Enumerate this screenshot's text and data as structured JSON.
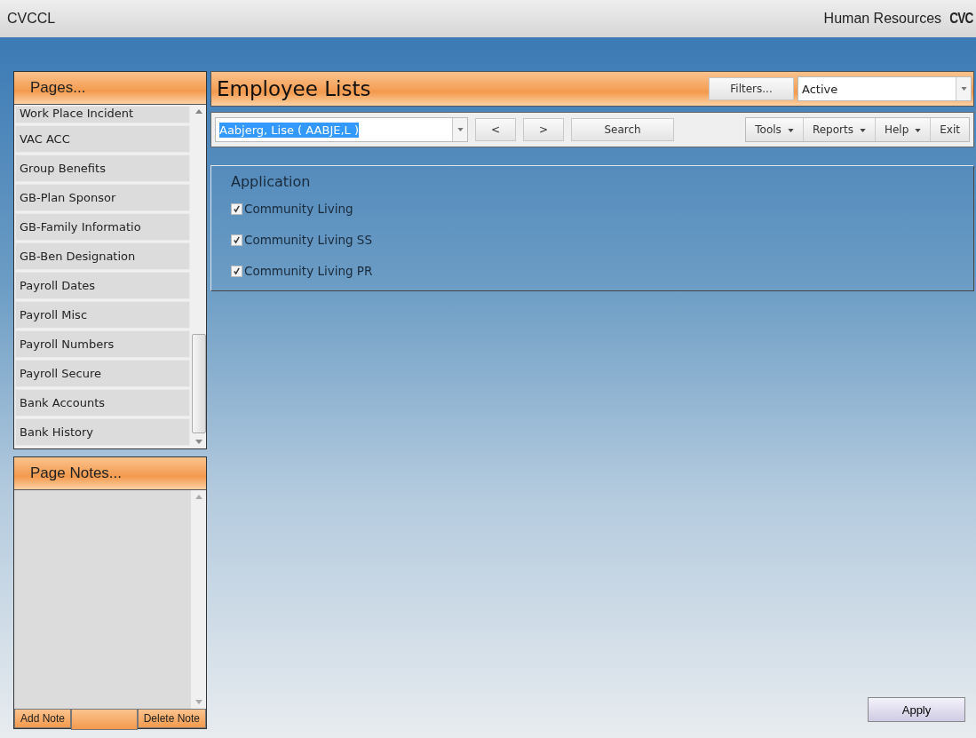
{
  "header": {
    "app_name": "CVCCL",
    "module": "Human Resources",
    "logo": "CVC"
  },
  "pages_panel": {
    "title": "Pages...",
    "items": [
      {
        "label": "Work Place Incident"
      },
      {
        "label": "VAC ACC"
      },
      {
        "label": "Group Benefits"
      },
      {
        "label": "GB-Plan Sponsor"
      },
      {
        "label": "GB-Family Informatio"
      },
      {
        "label": "GB-Ben Designation"
      },
      {
        "label": "Payroll Dates"
      },
      {
        "label": "Payroll Misc"
      },
      {
        "label": "Payroll Numbers"
      },
      {
        "label": "Payroll Secure"
      },
      {
        "label": "Bank Accounts"
      },
      {
        "label": "Bank History"
      }
    ]
  },
  "notes_panel": {
    "title": "Page Notes...",
    "buttons": [
      "Add Note",
      "Delete Note"
    ]
  },
  "main": {
    "title": "Employee Lists",
    "filters_button": "Filters...",
    "filter_value": "Active",
    "employee": "Aabjerg, Lise ( AABJE,L )",
    "nav_buttons": [
      "<",
      ">",
      "Search"
    ],
    "menus": [
      {
        "label": "Tools",
        "kind": "menu"
      },
      {
        "label": "Reports",
        "kind": "menu"
      },
      {
        "label": "Help",
        "kind": "menu"
      },
      {
        "label": "Exit",
        "kind": "button"
      }
    ],
    "application": {
      "title": "Application",
      "options": [
        {
          "label": "Community Living",
          "checked": true
        },
        {
          "label": "Community Living SS",
          "checked": true
        },
        {
          "label": "Community Living PR",
          "checked": true
        }
      ]
    },
    "apply_button": "Apply"
  }
}
